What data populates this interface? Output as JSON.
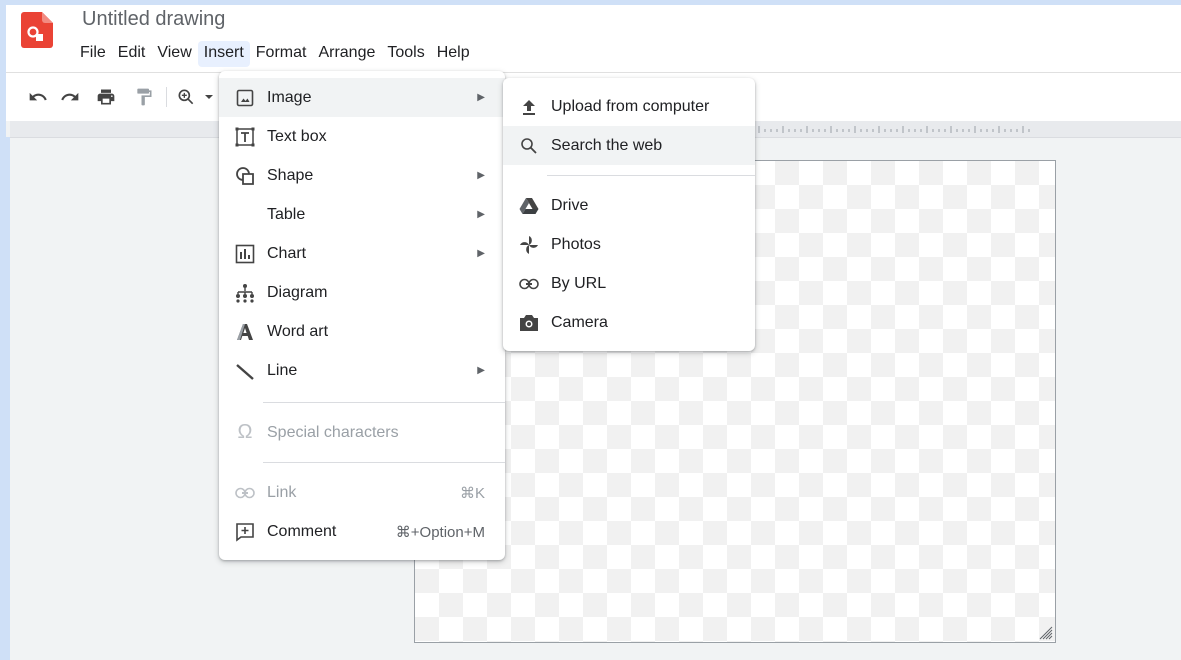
{
  "app": {
    "document_title": "Untitled drawing"
  },
  "menubar": [
    {
      "label": "File"
    },
    {
      "label": "Edit"
    },
    {
      "label": "View"
    },
    {
      "label": "Insert"
    },
    {
      "label": "Format"
    },
    {
      "label": "Arrange"
    },
    {
      "label": "Tools"
    },
    {
      "label": "Help"
    }
  ],
  "toolbar": {
    "icons": [
      "undo-icon",
      "redo-icon",
      "print-icon",
      "paint-format-icon",
      "zoom-icon",
      "zoom-dropdown-icon"
    ]
  },
  "insert_menu": {
    "items": [
      {
        "label": "Image",
        "icon": "image-icon",
        "submenu": true
      },
      {
        "label": "Text box",
        "icon": "text-box-icon"
      },
      {
        "label": "Shape",
        "icon": "shape-icon",
        "submenu": true
      },
      {
        "label": "Table",
        "icon": "",
        "submenu": true
      },
      {
        "label": "Chart",
        "icon": "chart-icon",
        "submenu": true
      },
      {
        "label": "Diagram",
        "icon": "diagram-icon"
      },
      {
        "label": "Word art",
        "icon": "word-art-icon"
      },
      {
        "label": "Line",
        "icon": "line-icon",
        "submenu": true
      },
      {
        "label": "Special characters",
        "icon": "omega-icon",
        "disabled": true
      },
      {
        "label": "Link",
        "icon": "link-icon",
        "shortcut": "⌘K",
        "disabled": true
      },
      {
        "label": "Comment",
        "icon": "comment-icon",
        "shortcut": "⌘+Option+M"
      }
    ]
  },
  "image_submenu": {
    "items": [
      {
        "label": "Upload from computer",
        "icon": "upload-icon"
      },
      {
        "label": "Search the web",
        "icon": "search-icon"
      },
      {
        "label": "Drive",
        "icon": "drive-icon"
      },
      {
        "label": "Photos",
        "icon": "photos-icon"
      },
      {
        "label": "By URL",
        "icon": "link-icon"
      },
      {
        "label": "Camera",
        "icon": "camera-icon"
      }
    ]
  },
  "colors": {
    "brand_red": "#ea4335",
    "active_menu_bg": "#e8f0fe",
    "menu_highlight": "#f1f3f4",
    "drive_gray": "#5f6368"
  }
}
